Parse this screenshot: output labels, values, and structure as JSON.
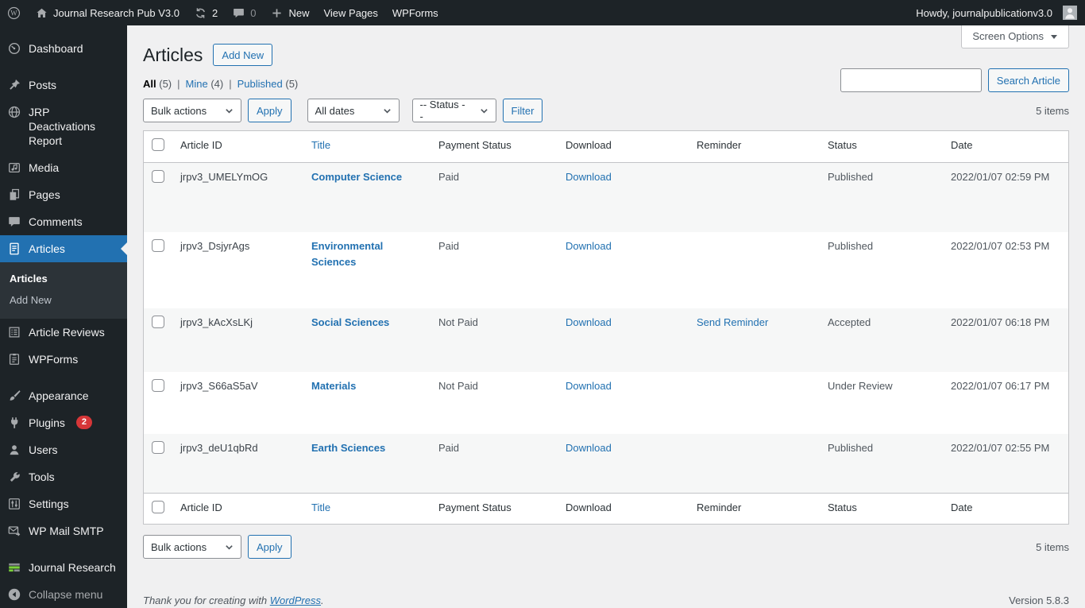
{
  "admin_bar": {
    "site_name": "Journal Research Pub V3.0",
    "updates_count": "2",
    "comments_count": "0",
    "new_label": "New",
    "view_pages_label": "View Pages",
    "wpforms_label": "WPForms",
    "howdy": "Howdy, journalpublicationv3.0"
  },
  "sidebar": {
    "items": [
      {
        "label": "Dashboard"
      },
      {
        "label": "Posts"
      },
      {
        "label": "JRP Deactivations Report"
      },
      {
        "label": "Media"
      },
      {
        "label": "Pages"
      },
      {
        "label": "Comments"
      },
      {
        "label": "Articles",
        "active": true,
        "submenu": [
          {
            "label": "Articles",
            "current": true
          },
          {
            "label": "Add New"
          }
        ]
      },
      {
        "label": "Article Reviews"
      },
      {
        "label": "WPForms"
      },
      {
        "label": "Appearance"
      },
      {
        "label": "Plugins",
        "badge": "2"
      },
      {
        "label": "Users"
      },
      {
        "label": "Tools"
      },
      {
        "label": "Settings"
      },
      {
        "label": "WP Mail SMTP"
      },
      {
        "label": "Journal Research"
      },
      {
        "label": "Collapse menu"
      }
    ]
  },
  "page": {
    "screen_options_label": "Screen Options",
    "title": "Articles",
    "add_new_label": "Add New",
    "views_separator": "|",
    "views": [
      {
        "label": "All",
        "count": "(5)",
        "current": true
      },
      {
        "label": "Mine",
        "count": "(4)"
      },
      {
        "label": "Published",
        "count": "(5)"
      }
    ],
    "bulk_actions_label": "Bulk actions",
    "apply_label": "Apply",
    "dates_filter_label": "All dates",
    "status_filter_label": "-- Status --",
    "filter_label": "Filter",
    "search_button_label": "Search Article",
    "items_count": "5 items"
  },
  "table": {
    "headers": [
      "Article ID",
      "Title",
      "Payment Status",
      "Download",
      "Reminder",
      "Status",
      "Date"
    ],
    "rows": [
      {
        "article_id": "jrpv3_UMELYmOG",
        "title": "Computer Science",
        "payment_status": "Paid",
        "download_label": "Download",
        "reminder_label": "",
        "status": "Published",
        "date": "2022/01/07 02:59 PM"
      },
      {
        "article_id": "jrpv3_DsjyrAgs",
        "title": "Environmental Sciences",
        "payment_status": "Paid",
        "download_label": "Download",
        "reminder_label": "",
        "status": "Published",
        "date": "2022/01/07 02:53 PM"
      },
      {
        "article_id": "jrpv3_kAcXsLKj",
        "title": "Social Sciences",
        "payment_status": "Not Paid",
        "download_label": "Download",
        "reminder_label": "Send Reminder",
        "status": "Accepted",
        "date": "2022/01/07 06:18 PM"
      },
      {
        "article_id": "jrpv3_S66aS5aV",
        "title": "Materials",
        "payment_status": "Not Paid",
        "download_label": "Download",
        "reminder_label": "",
        "status": "Under Review",
        "date": "2022/01/07 06:17 PM"
      },
      {
        "article_id": "jrpv3_deU1qbRd",
        "title": "Earth Sciences",
        "payment_status": "Paid",
        "download_label": "Download",
        "reminder_label": "",
        "status": "Published",
        "date": "2022/01/07 02:55 PM"
      }
    ]
  },
  "footer": {
    "thanks_prefix": "Thank you for creating with ",
    "wordpress_link": "WordPress",
    "thanks_suffix": ".",
    "version": "Version 5.8.3"
  },
  "colors": {
    "accent": "#2271b1",
    "admin_dark": "#1d2327",
    "submenu_bg": "#2c3338",
    "badge_red": "#d63638",
    "stripe": "#f6f7f7",
    "content_bg": "#f0f0f1",
    "brand_green": "#7ad03a"
  }
}
